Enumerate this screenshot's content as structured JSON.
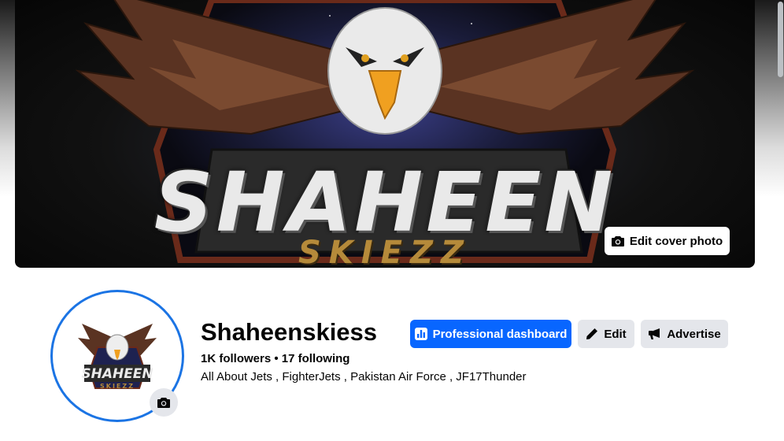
{
  "cover": {
    "title_text": "SHAHEEN",
    "subtitle_text": "SKIEZZ",
    "edit_cover_label": "Edit cover photo"
  },
  "profile": {
    "name": "Shaheenskiess",
    "followers": "1K followers • 17 following",
    "bio": "All About Jets , FighterJets , Pakistan Air Force , JF17Thunder",
    "avatar_title": "SHAHEEN",
    "avatar_subtitle": "SKIEZZ"
  },
  "actions": {
    "professional_dashboard": "Professional dashboard",
    "edit": "Edit",
    "advertise": "Advertise"
  },
  "colors": {
    "primary": "#0866ff",
    "ring": "#1b74e4",
    "secondary_button": "#e4e6eb"
  }
}
